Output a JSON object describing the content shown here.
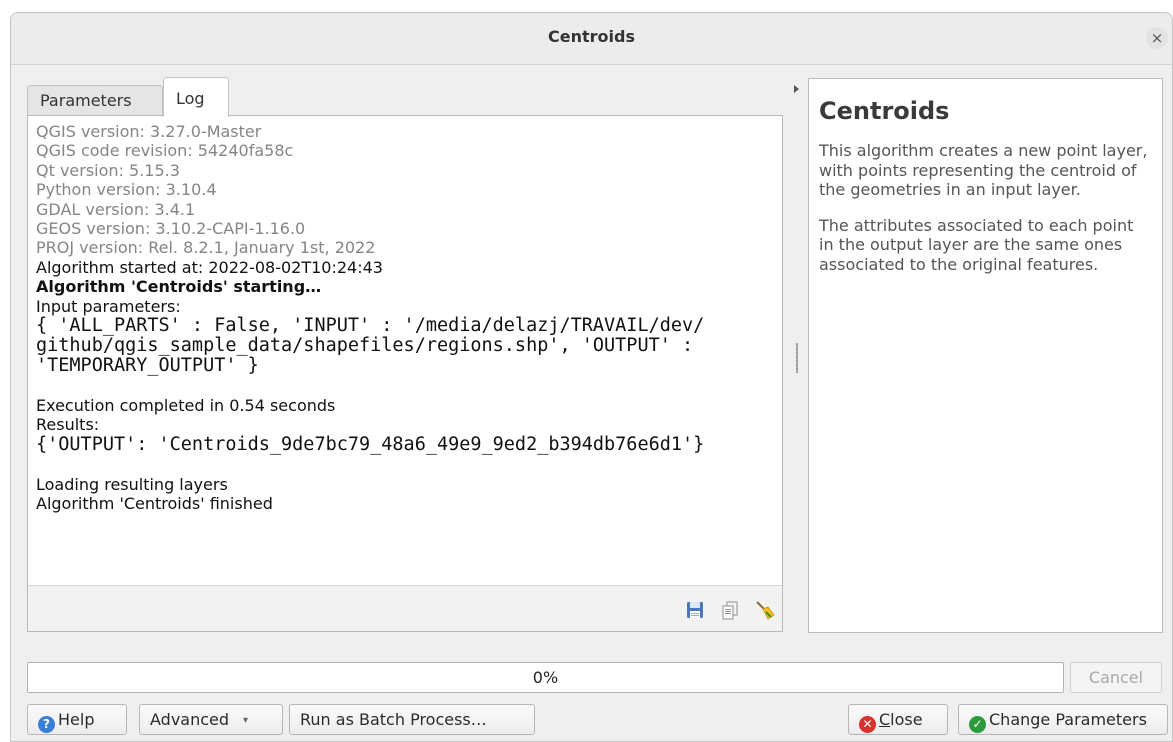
{
  "window": {
    "title": "Centroids",
    "close_symbol": "×"
  },
  "tabs": [
    {
      "label": "Parameters",
      "active": false
    },
    {
      "label": "Log",
      "active": true
    }
  ],
  "log": {
    "version_lines": [
      "QGIS version: 3.27.0-Master",
      "QGIS code revision: 54240fa58c",
      "Qt version: 5.15.3",
      "Python version: 3.10.4",
      "GDAL version: 3.4.1",
      "GEOS version: 3.10.2-CAPI-1.16.0",
      "PROJ version: Rel. 8.2.1, January 1st, 2022"
    ],
    "started": "Algorithm started at: 2022-08-02T10:24:43",
    "starting": "Algorithm 'Centroids' starting…",
    "input_params_label": "Input parameters:",
    "input_params": [
      "{ 'ALL_PARTS' : False, 'INPUT' : '/media/delazj/TRAVAIL/dev/",
      "github/qgis_sample_data/shapefiles/regions.shp', 'OUTPUT' :",
      "'TEMPORARY_OUTPUT' }"
    ],
    "execution": "Execution completed in 0.54 seconds",
    "results_label": "Results:",
    "results": "{'OUTPUT': 'Centroids_9de7bc79_48a6_49e9_9ed2_b394db76e6d1'}",
    "loading": "Loading resulting layers",
    "finished": "Algorithm 'Centroids' finished"
  },
  "log_tools": [
    "save-log-icon",
    "copy-log-icon",
    "clear-log-icon"
  ],
  "help": {
    "title": "Centroids",
    "paragraphs": [
      "This algorithm creates a new point layer, with points representing the centroid of the geometries in an input layer.",
      "The attributes associated to each point in the output layer are the same ones associated to the original features."
    ]
  },
  "progress": {
    "value": 0,
    "label": "0%"
  },
  "buttons": {
    "cancel": "Cancel",
    "help": "Help",
    "advanced": "Advanced",
    "batch": "Run as Batch Process…",
    "close_prefix": "",
    "close_mnemonic": "C",
    "close_rest": "lose",
    "change": "Change Parameters"
  },
  "colors": {
    "help_icon": "#3a7fd5",
    "close_icon": "#d8322f",
    "change_icon": "#2e9a3e",
    "progress_fill": "#3d8ee0"
  }
}
